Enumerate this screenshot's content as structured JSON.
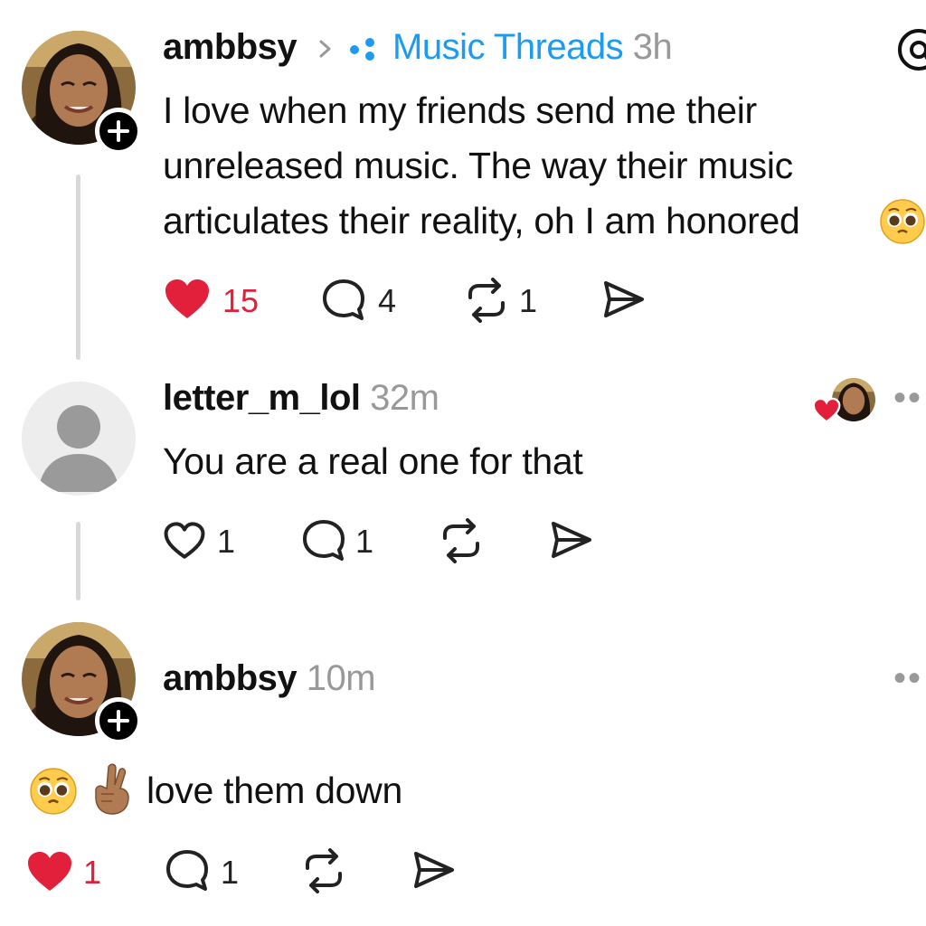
{
  "post": {
    "username": "ambbsy",
    "community": "Music Threads",
    "time": "3h",
    "lines": [
      "I love when my friends send me their",
      "unreleased music. The way their music",
      "articulates their reality, oh I am honored"
    ],
    "likes": "15",
    "comments": "4",
    "reposts": "1",
    "liked": true
  },
  "reply1": {
    "username": "letter_m_lol",
    "time": "32m",
    "text": "You are a real one for that",
    "likes": "1",
    "comments": "1",
    "liked": false
  },
  "reply2": {
    "username": "ambbsy",
    "time": "10m",
    "text": "love them down",
    "likes": "1",
    "comments": "1",
    "liked": true
  },
  "colors": {
    "like_red": "#e3203c",
    "community_blue": "#1d9bf0",
    "muted": "#999999",
    "thread_line": "#d9d9d9"
  },
  "icons": [
    "heart-icon",
    "comment-icon",
    "repost-icon",
    "share-icon",
    "plus-icon",
    "chevron-right-icon",
    "community-icon",
    "mention-icon",
    "more-icon",
    "pleading-face-emoji",
    "crossed-fingers-emoji"
  ]
}
